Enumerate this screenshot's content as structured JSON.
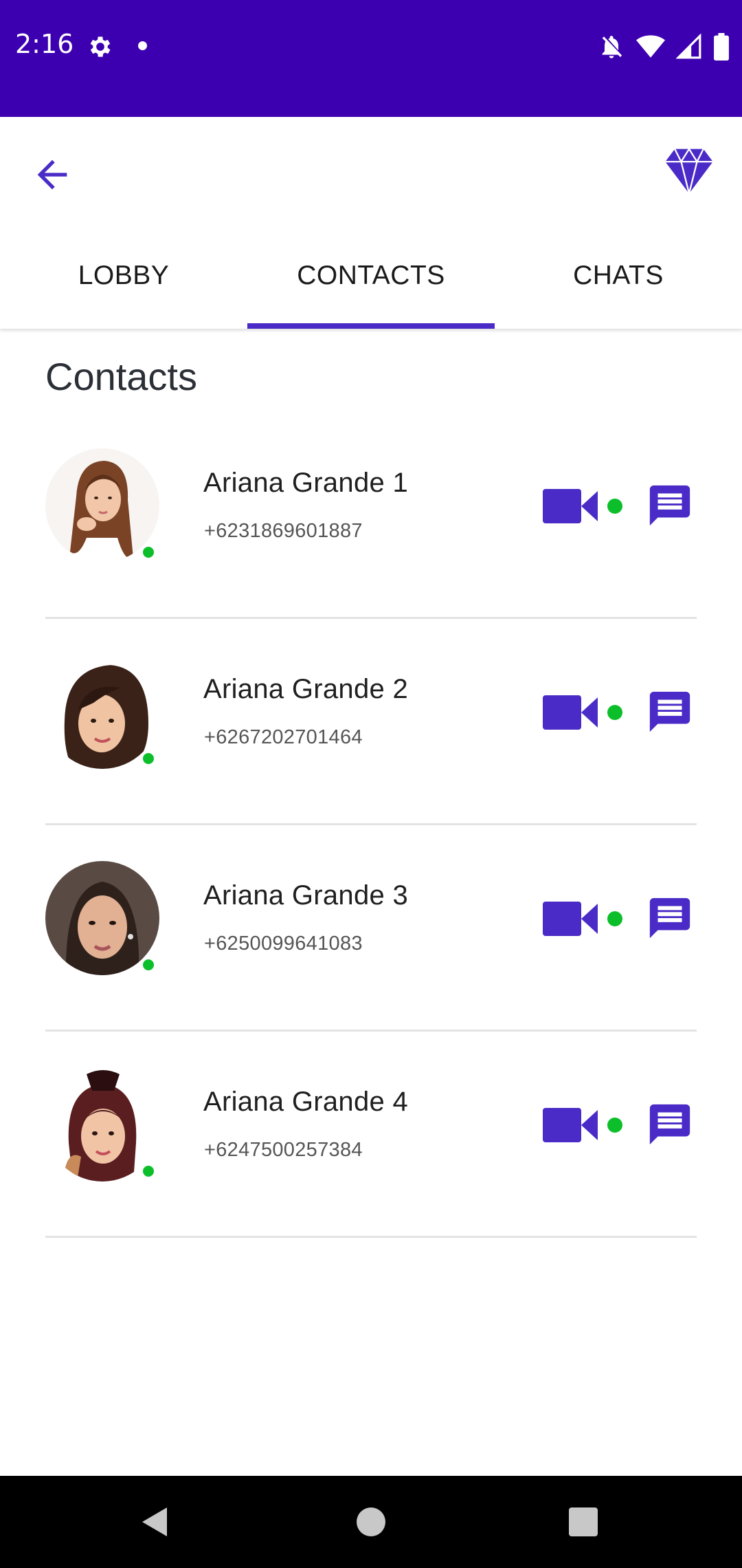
{
  "status_bar": {
    "time": "2:16",
    "background_color": "#3d00b0",
    "icons": [
      "gear-icon",
      "notification-dot-icon",
      "bell-off-icon",
      "wifi-icon",
      "cellular-signal-icon",
      "battery-icon"
    ]
  },
  "app_bar": {
    "back_icon": "arrow-left-icon",
    "action_icon": "diamond-icon",
    "accent_color": "#4a2bc7"
  },
  "tabs": [
    {
      "label": "LOBBY",
      "active": false
    },
    {
      "label": "CONTACTS",
      "active": true
    },
    {
      "label": "CHATS",
      "active": false
    }
  ],
  "main": {
    "section_title": "Contacts",
    "contacts": [
      {
        "name": "Ariana Grande 1",
        "phone": "+6231869601887",
        "online": true,
        "video_online": true
      },
      {
        "name": "Ariana Grande 2",
        "phone": "+6267202701464",
        "online": true,
        "video_online": true
      },
      {
        "name": "Ariana Grande 3",
        "phone": "+6250099641083",
        "online": true,
        "video_online": true
      },
      {
        "name": "Ariana Grande 4",
        "phone": "+6247500257384",
        "online": true,
        "video_online": true
      }
    ],
    "online_color": "#0cbf2a",
    "action_icons": [
      "video-camera-icon",
      "chat-message-icon"
    ]
  },
  "nav_bar": {
    "icons": [
      "nav-back-icon",
      "nav-home-icon",
      "nav-recents-icon"
    ]
  }
}
